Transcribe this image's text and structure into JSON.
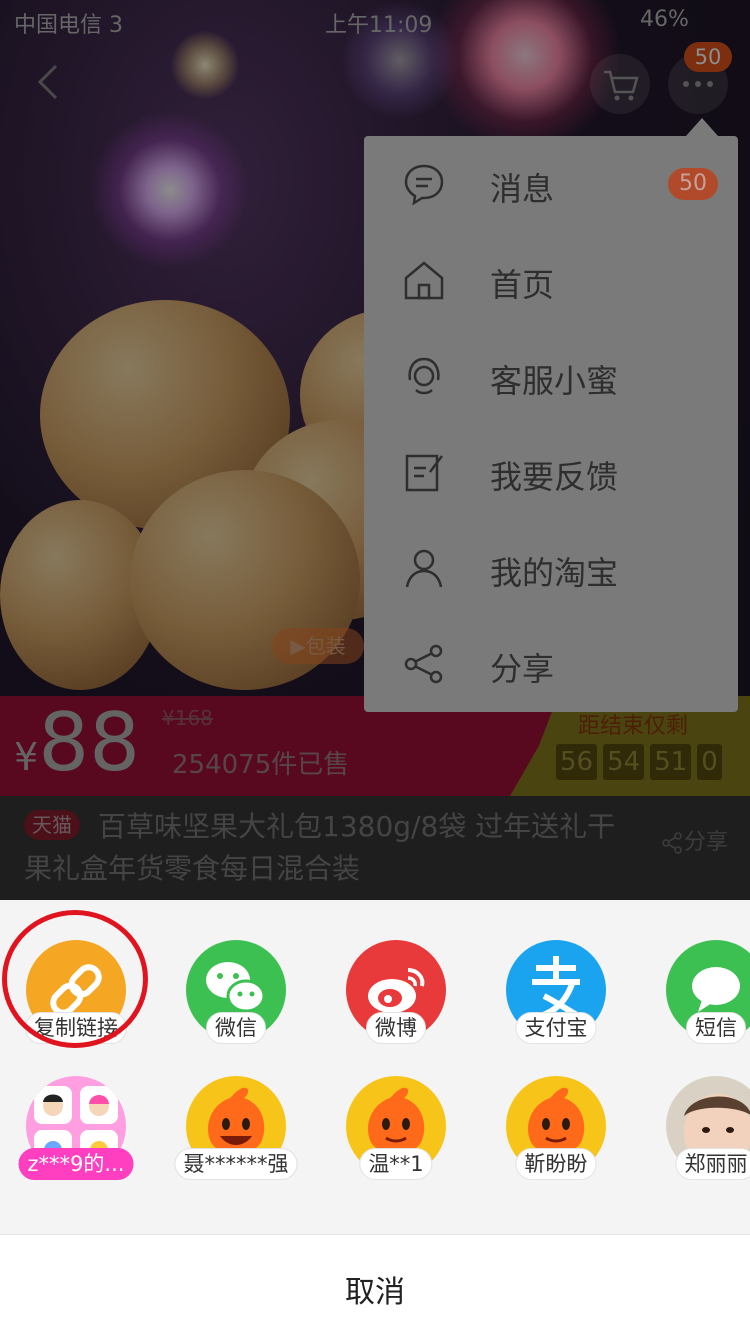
{
  "status_bar": {
    "carrier": "中国电信 3",
    "time": "上午11:09",
    "battery": "46%"
  },
  "header": {
    "message_badge": "50"
  },
  "product": {
    "video_tag": "▶包装",
    "price_symbol": "¥",
    "price": "88",
    "original_price": "¥168",
    "sold_count": "254075件已售",
    "countdown_label": "距结束仅剩",
    "countdown": [
      "56",
      "54",
      "51",
      "0"
    ],
    "tag": "天猫",
    "title": "百草味坚果大礼包1380g/8袋 过年送礼干果礼盒年货零食每日混合装",
    "share_label": "分享"
  },
  "menu": {
    "items": [
      {
        "label": "消息",
        "badge": "50",
        "icon": "chat-icon"
      },
      {
        "label": "首页",
        "icon": "home-icon"
      },
      {
        "label": "客服小蜜",
        "icon": "customer-service-icon"
      },
      {
        "label": "我要反馈",
        "icon": "feedback-icon"
      },
      {
        "label": "我的淘宝",
        "icon": "user-icon"
      },
      {
        "label": "分享",
        "icon": "share-icon"
      }
    ]
  },
  "share_sheet": {
    "apps": [
      {
        "label": "复制链接",
        "icon": "link-icon",
        "color": "#f5a623"
      },
      {
        "label": "微信",
        "icon": "wechat-icon",
        "color": "#3cc051"
      },
      {
        "label": "微博",
        "icon": "weibo-icon",
        "color": "#e83a3a"
      },
      {
        "label": "支付宝",
        "icon": "alipay-icon",
        "color": "#1aa3ee"
      },
      {
        "label": "短信",
        "icon": "sms-icon",
        "color": "#3cc051"
      }
    ],
    "contacts": [
      {
        "label": "z***9的...",
        "icon": "group-avatar-icon"
      },
      {
        "label": "聂******强",
        "icon": "taobao-avatar-icon"
      },
      {
        "label": "温**1",
        "icon": "taobao-avatar-icon"
      },
      {
        "label": "靳盼盼",
        "icon": "taobao-avatar-icon"
      },
      {
        "label": "郑丽丽",
        "icon": "baby-photo-avatar"
      }
    ],
    "cancel_label": "取消"
  },
  "colors": {
    "highlight_circle": "#e0141e",
    "badge": "#e2541c"
  }
}
